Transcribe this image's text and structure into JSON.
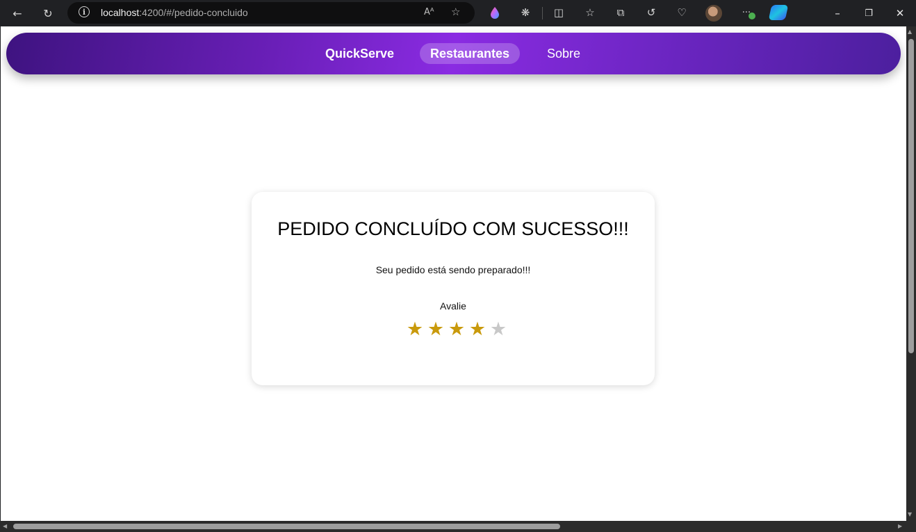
{
  "browser": {
    "url_host": "localhost",
    "url_path": ":4200/#/pedido-concluido",
    "icons": {
      "back": "back-arrow-icon",
      "refresh": "refresh-icon",
      "info": "info-icon",
      "read_aloud": "read-aloud-icon",
      "favorite": "star-outline-icon",
      "minimize": "minimize-icon",
      "restore": "restore-icon",
      "close": "close-icon"
    },
    "read_aloud_glyph": "Aᴬ",
    "info_glyph": "i",
    "more_glyph": "···"
  },
  "nav": {
    "brand": "QuickServe",
    "items": [
      {
        "label": "Restaurantes",
        "active": true
      },
      {
        "label": "Sobre",
        "active": false
      }
    ]
  },
  "card": {
    "title": "PEDIDO CONCLUÍDO COM SUCESSO!!!",
    "subtitle": "Seu pedido está sendo preparado!!!",
    "rating_label": "Avalie",
    "rating": 4,
    "rating_max": 5
  },
  "colors": {
    "star_filled": "#c99a0c",
    "star_empty": "#c8c8c8",
    "nav_gradient_center": "#8a2be2"
  }
}
